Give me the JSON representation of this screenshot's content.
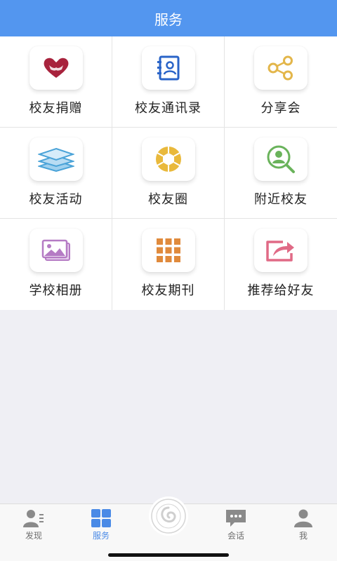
{
  "header": {
    "title": "服务"
  },
  "services": [
    {
      "label": "校友捐赠",
      "icon": "heart-hands-icon",
      "color": "#a8233d"
    },
    {
      "label": "校友通讯录",
      "icon": "address-book-icon",
      "color": "#2a64c8"
    },
    {
      "label": "分享会",
      "icon": "share-icon",
      "color": "#e3b64a"
    },
    {
      "label": "校友活动",
      "icon": "layers-icon",
      "color": "#4aa3d8"
    },
    {
      "label": "校友圈",
      "icon": "aperture-icon",
      "color": "#e9b93c"
    },
    {
      "label": "附近校友",
      "icon": "search-person-icon",
      "color": "#6ab35b"
    },
    {
      "label": "学校相册",
      "icon": "photo-album-icon",
      "color": "#b57bc4"
    },
    {
      "label": "校友期刊",
      "icon": "grid-icon",
      "color": "#e08a3c"
    },
    {
      "label": "推荐给好友",
      "icon": "forward-share-icon",
      "color": "#e06a86"
    }
  ],
  "tabbar": {
    "items": [
      {
        "label": "发现",
        "icon": "discover-person-icon"
      },
      {
        "label": "服务",
        "icon": "services-grid-icon"
      },
      {
        "label": "会话",
        "icon": "chat-bubble-icon"
      },
      {
        "label": "我",
        "icon": "user-icon"
      }
    ],
    "active_color": "#4a8ae6",
    "center_logo": "school-logo-icon"
  }
}
